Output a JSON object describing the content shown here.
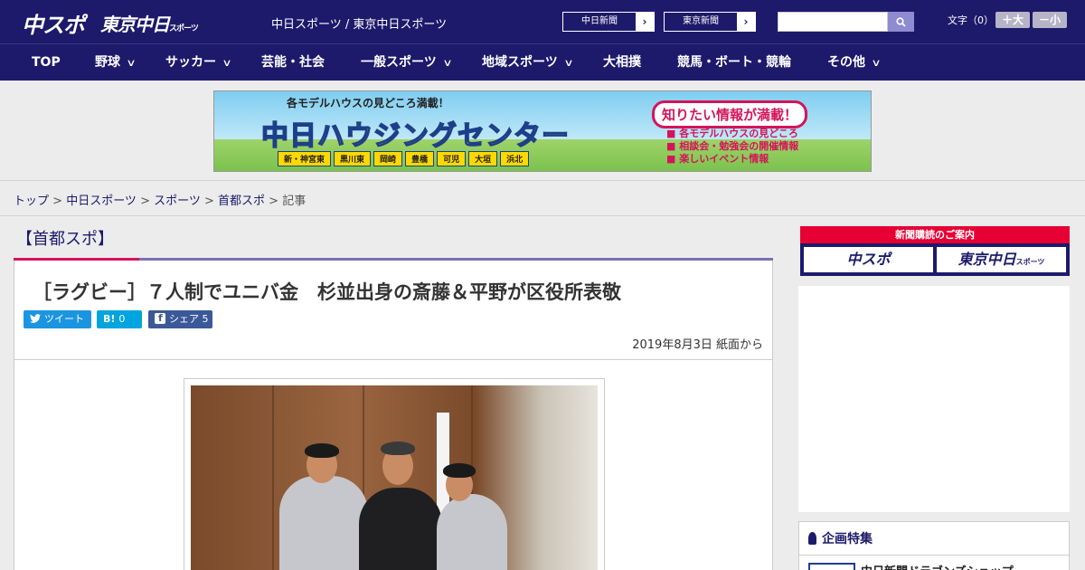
{
  "header": {
    "logo_chuspo": "中スポ",
    "logo_tokyo": "東京中日",
    "logo_tokyo_suffix": "スポーツ",
    "subtitle": "中日スポーツ / 東京中日スポーツ",
    "paper_links": [
      "中日新聞",
      "東京新聞"
    ],
    "search_placeholder": "",
    "font_size_label": "文字（0）",
    "font_larger": "＋大",
    "font_smaller": "－小"
  },
  "nav": {
    "items": [
      {
        "label": "TOP",
        "has_menu": false
      },
      {
        "label": "野球",
        "has_menu": true
      },
      {
        "label": "サッカー",
        "has_menu": true
      },
      {
        "label": "芸能・社会",
        "has_menu": false
      },
      {
        "label": "一般スポーツ",
        "has_menu": true
      },
      {
        "label": "地域スポーツ",
        "has_menu": true
      },
      {
        "label": "大相撲",
        "has_menu": false
      },
      {
        "label": "競馬・ボート・競輪",
        "has_menu": false
      },
      {
        "label": "その他",
        "has_menu": true
      }
    ]
  },
  "banner": {
    "tagline": "各モデルハウスの見どころ満載！",
    "title": "中日ハウジングセンター",
    "cities": [
      "新・神宮東",
      "黒川東",
      "岡崎",
      "豊橋",
      "可児",
      "大垣",
      "浜北"
    ],
    "bubble": "知りたい情報が満載！",
    "points": [
      "各モデルハウスの見どころ",
      "相談会・勉強会の開催情報",
      "楽しいイベント情報"
    ]
  },
  "breadcrumb": {
    "items": [
      "トップ",
      "中日スポーツ",
      "スポーツ",
      "首都スポ"
    ],
    "current": "記事",
    "separator": " > "
  },
  "article": {
    "section": "【首都スポ】",
    "title": "［ラグビー］７人制でユニバ金　杉並出身の斎藤＆平野が区役所表敬",
    "share": {
      "tweet": "ツイート",
      "hatena_icon": "B!",
      "hatena_count": "0",
      "facebook": "シェア",
      "facebook_count": "5"
    },
    "date": "2019年8月3日 紙面から"
  },
  "sidebar": {
    "subscribe_head": "新聞購読のご案内",
    "subscribe_chuspo": "中スポ",
    "subscribe_tokyo": "東京中日",
    "subscribe_tokyo_suffix": "スポーツ",
    "feature_title": "企画特集",
    "feature_item": "中日新聞ドラゴンズショップ"
  },
  "colors": {
    "brand_navy": "#1d1a6b",
    "accent_red": "#e60033",
    "twitter": "#1b95e0",
    "hatena": "#00a4de",
    "facebook": "#3b5998"
  }
}
